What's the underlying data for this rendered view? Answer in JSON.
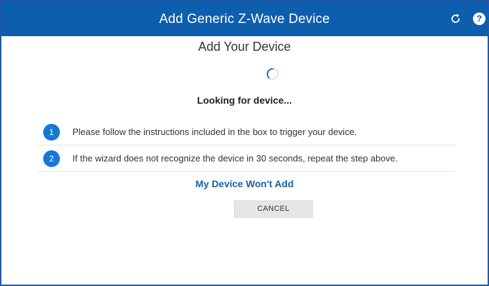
{
  "window": {
    "title": "Add Generic Z-Wave Device",
    "refresh_icon": "refresh-icon",
    "help_label": "?",
    "accent_color": "#0d5ead"
  },
  "main": {
    "heading": "Add Your Device",
    "spinner_icon": "loading-spinner-icon",
    "status": "Looking for device...",
    "steps": [
      {
        "number": "1",
        "text": "Please follow the instructions included in the box to trigger your device."
      },
      {
        "number": "2",
        "text": "If the wizard does not recognize the device in 30 seconds, repeat the step above."
      }
    ],
    "help_link": "My Device Won't Add",
    "cancel_label": "CANCEL"
  }
}
